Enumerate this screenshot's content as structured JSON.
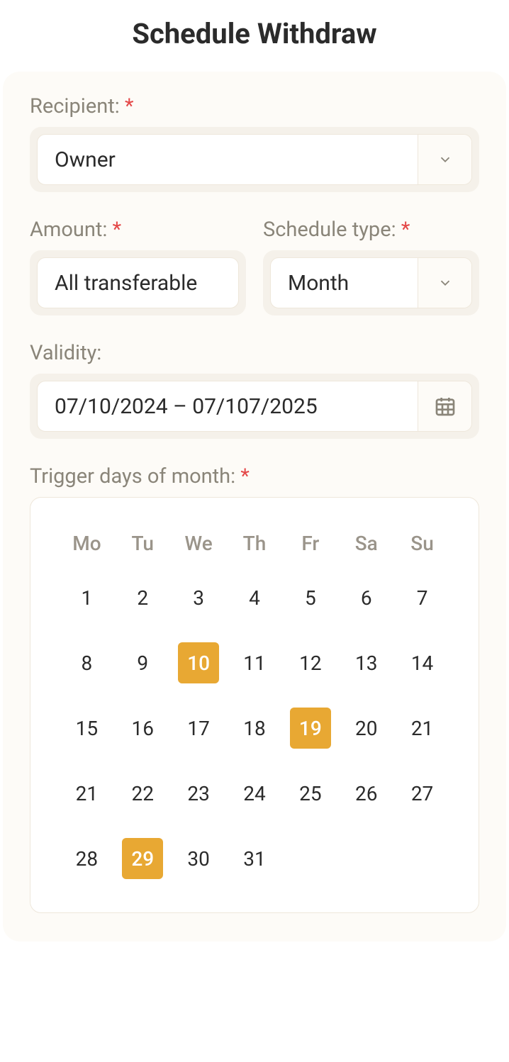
{
  "title": "Schedule Withdraw",
  "fields": {
    "recipient": {
      "label": "Recipient:",
      "required": true,
      "value": "Owner"
    },
    "amount": {
      "label": "Amount:",
      "required": true,
      "value": "All transferable"
    },
    "scheduleType": {
      "label": "Schedule type:",
      "required": true,
      "value": "Month"
    },
    "validity": {
      "label": "Validity:",
      "required": false,
      "value": "07/10/2024 – 07/107/2025"
    },
    "triggerDays": {
      "label": "Trigger days of month:",
      "required": true
    }
  },
  "calendar": {
    "dow": [
      "Mo",
      "Tu",
      "We",
      "Th",
      "Fr",
      "Sa",
      "Su"
    ],
    "days": [
      {
        "n": 1
      },
      {
        "n": 2
      },
      {
        "n": 3
      },
      {
        "n": 4
      },
      {
        "n": 5
      },
      {
        "n": 6
      },
      {
        "n": 7
      },
      {
        "n": 8
      },
      {
        "n": 9
      },
      {
        "n": 10,
        "sel": true
      },
      {
        "n": 11
      },
      {
        "n": 12
      },
      {
        "n": 13
      },
      {
        "n": 14
      },
      {
        "n": 15
      },
      {
        "n": 16
      },
      {
        "n": 17
      },
      {
        "n": 18
      },
      {
        "n": 19,
        "sel": true
      },
      {
        "n": 20
      },
      {
        "n": 21
      },
      {
        "n": 21
      },
      {
        "n": 22
      },
      {
        "n": 23
      },
      {
        "n": 24
      },
      {
        "n": 25
      },
      {
        "n": 26
      },
      {
        "n": 27
      },
      {
        "n": 28
      },
      {
        "n": 29,
        "sel": true
      },
      {
        "n": 30
      },
      {
        "n": 31
      }
    ]
  },
  "requiredMark": "*"
}
